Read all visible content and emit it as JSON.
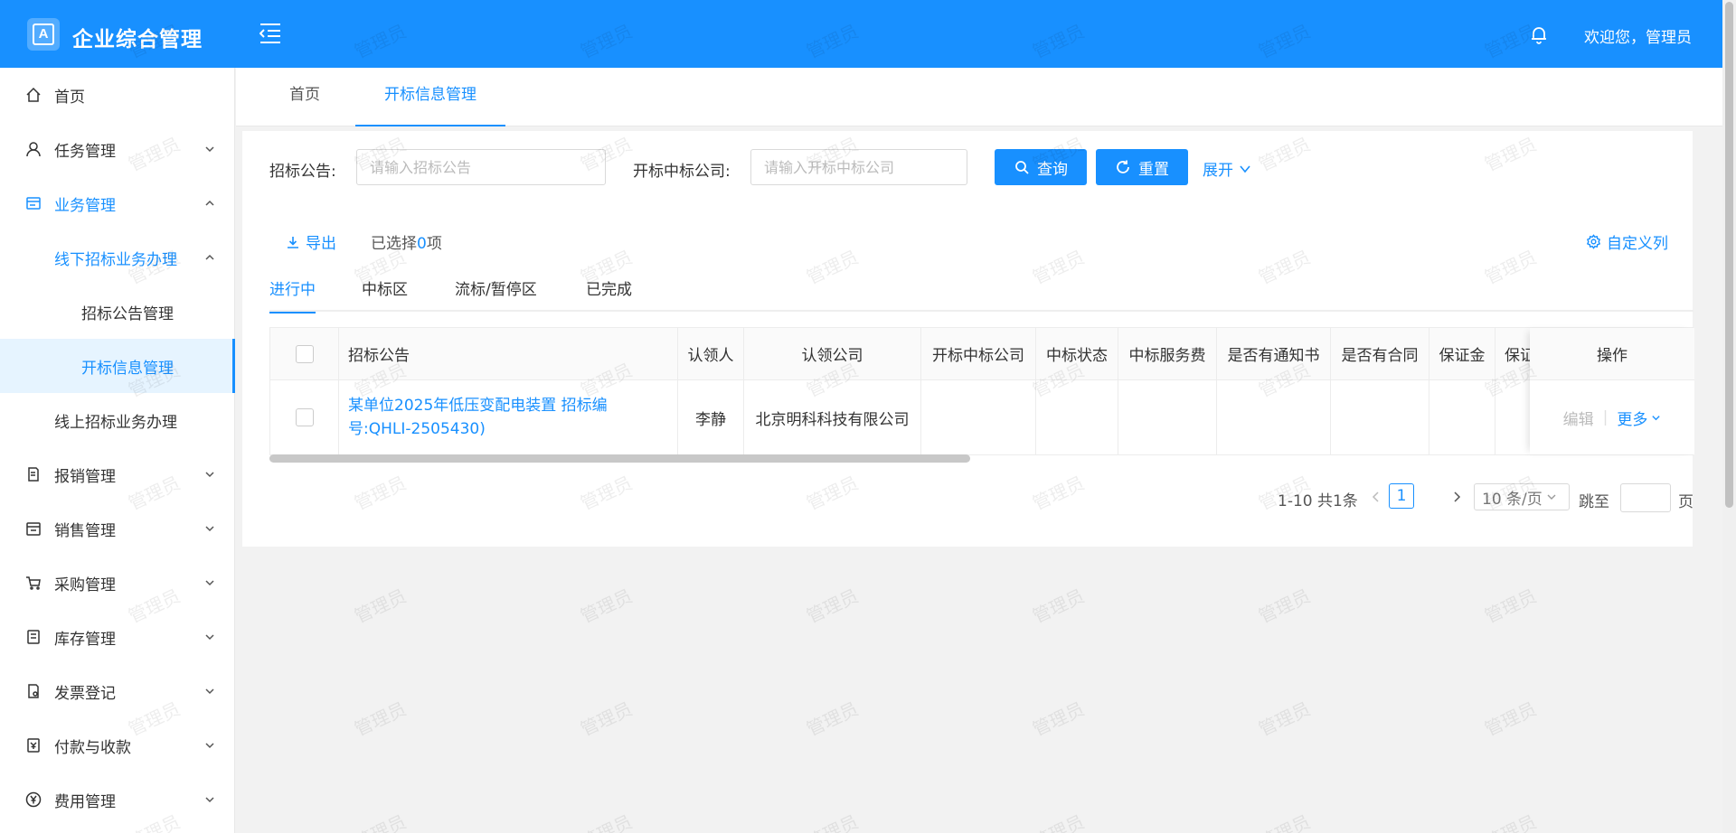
{
  "header": {
    "logo_char": "A",
    "title": "企业综合管理",
    "welcome": "欢迎您，管理员"
  },
  "sidebar": {
    "items": [
      {
        "label": "首页",
        "icon": "home-icon"
      },
      {
        "label": "任务管理",
        "icon": "user-icon"
      },
      {
        "label": "业务管理",
        "icon": "business-icon"
      },
      {
        "label": "线下招标业务办理"
      },
      {
        "label": "招标公告管理"
      },
      {
        "label": "开标信息管理"
      },
      {
        "label": "线上招标业务办理"
      },
      {
        "label": "报销管理",
        "icon": "receipt-icon"
      },
      {
        "label": "销售管理",
        "icon": "store-icon"
      },
      {
        "label": "采购管理",
        "icon": "cart-icon"
      },
      {
        "label": "库存管理",
        "icon": "inventory-icon"
      },
      {
        "label": "发票登记",
        "icon": "invoice-icon"
      },
      {
        "label": "付款与收款",
        "icon": "payment-icon"
      },
      {
        "label": "费用管理",
        "icon": "yen-icon"
      }
    ]
  },
  "page_tabs": [
    "首页",
    "开标信息管理"
  ],
  "filters": {
    "announcement_label": "招标公告:",
    "announcement_placeholder": "请输入招标公告",
    "company_label": "开标中标公司:",
    "company_placeholder": "请输入开标中标公司",
    "search_label": "查询",
    "reset_label": "重置",
    "expand_label": "展开"
  },
  "toolbar": {
    "export_label": "导出",
    "selected_prefix": "已选择",
    "selected_count": "0",
    "selected_suffix": "项",
    "custom_columns_label": "自定义列"
  },
  "status_tabs": [
    "进行中",
    "中标区",
    "流标/暂停区",
    "已完成"
  ],
  "table": {
    "columns": [
      "招标公告",
      "认领人",
      "认领公司",
      "开标中标公司",
      "中标状态",
      "中标服务费",
      "是否有通知书",
      "是否有合同",
      "保证金",
      "保证",
      "操作"
    ],
    "rows": [
      {
        "announcement": "某单位2025年低压变配电装置 招标编号:QHLI-2505430)",
        "claimant": "李静",
        "claim_company": "北京明科科技有限公司",
        "edit": "编辑",
        "more": "更多"
      }
    ]
  },
  "pagination": {
    "summary": "1-10 共1条",
    "current_page": "1",
    "page_size": "10 条/页",
    "jump_label": "跳至",
    "page_suffix": "页"
  },
  "watermark": "管理员",
  "colors": {
    "primary": "#1890ff",
    "active_bg": "#e6f4ff"
  }
}
